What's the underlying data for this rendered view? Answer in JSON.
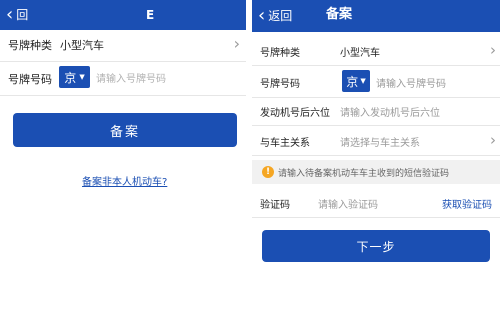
{
  "left": {
    "nav": {
      "back_label": "回",
      "title": "E"
    },
    "plate_type": {
      "label": "号牌种类",
      "value": "小型汽车"
    },
    "plate_number": {
      "label": "号牌号码",
      "province": "京",
      "placeholder": "请输入号牌号码"
    },
    "submit_label": "备案",
    "link_text": "备案非本人机动车?"
  },
  "right": {
    "nav": {
      "back_label": "返回",
      "title": "备案"
    },
    "plate_type": {
      "label": "号牌种类",
      "value": "小型汽车"
    },
    "plate_number": {
      "label": "号牌号码",
      "province": "京",
      "placeholder": "请输入号牌号码"
    },
    "engine": {
      "label": "发动机号后六位",
      "placeholder": "请输入发动机号后六位"
    },
    "relation": {
      "label": "与车主关系",
      "placeholder": "请选择与车主关系"
    },
    "notice": {
      "icon": "warning-icon",
      "text": "请输入待备案机动车车主收到的短信验证码"
    },
    "verify": {
      "label": "验证码",
      "placeholder": "请输入验证码",
      "get_code_label": "获取验证码"
    },
    "next_label": "下一步"
  },
  "colors": {
    "primary": "#1b4fb3",
    "notice_bg": "#f1f1f1",
    "warning": "#f5a623"
  }
}
